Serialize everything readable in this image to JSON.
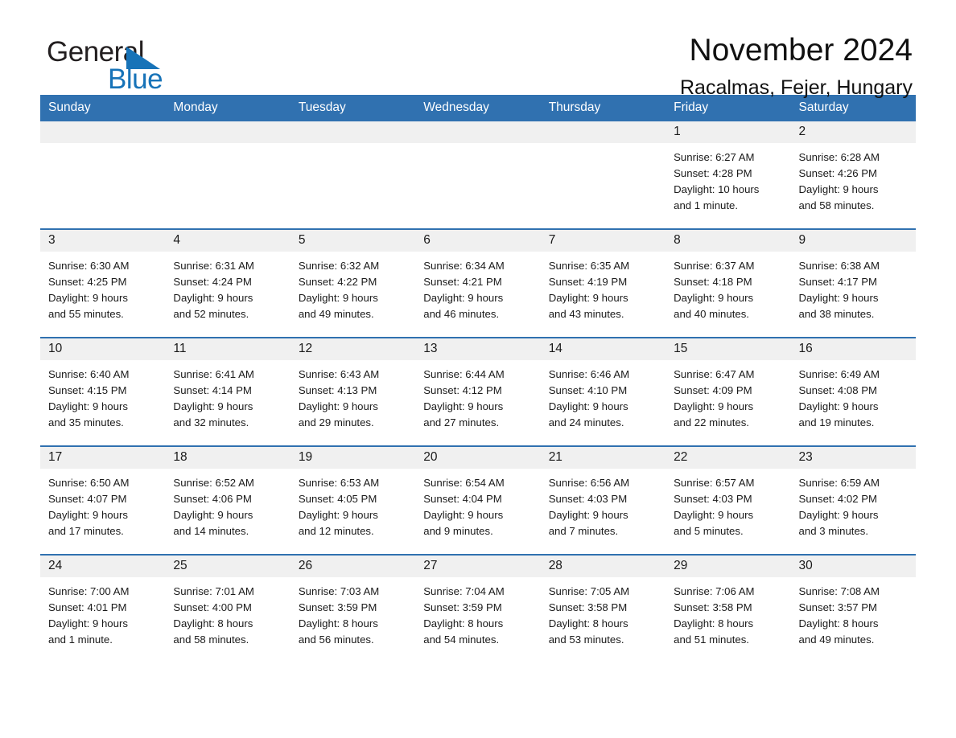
{
  "brand": {
    "name_part1": "General",
    "name_part2": "Blue",
    "accent_color": "#1773b8"
  },
  "header": {
    "month_title": "November 2024",
    "location": "Racalmas, Fejer, Hungary"
  },
  "calendar": {
    "header_bg": "#3071b0",
    "daynum_bg": "#f0f0f0",
    "weekday_headers": [
      "Sunday",
      "Monday",
      "Tuesday",
      "Wednesday",
      "Thursday",
      "Friday",
      "Saturday"
    ],
    "weeks": [
      [
        {
          "day": "",
          "lines": []
        },
        {
          "day": "",
          "lines": []
        },
        {
          "day": "",
          "lines": []
        },
        {
          "day": "",
          "lines": []
        },
        {
          "day": "",
          "lines": []
        },
        {
          "day": "1",
          "lines": [
            "Sunrise: 6:27 AM",
            "Sunset: 4:28 PM",
            "Daylight: 10 hours",
            "and 1 minute."
          ]
        },
        {
          "day": "2",
          "lines": [
            "Sunrise: 6:28 AM",
            "Sunset: 4:26 PM",
            "Daylight: 9 hours",
            "and 58 minutes."
          ]
        }
      ],
      [
        {
          "day": "3",
          "lines": [
            "Sunrise: 6:30 AM",
            "Sunset: 4:25 PM",
            "Daylight: 9 hours",
            "and 55 minutes."
          ]
        },
        {
          "day": "4",
          "lines": [
            "Sunrise: 6:31 AM",
            "Sunset: 4:24 PM",
            "Daylight: 9 hours",
            "and 52 minutes."
          ]
        },
        {
          "day": "5",
          "lines": [
            "Sunrise: 6:32 AM",
            "Sunset: 4:22 PM",
            "Daylight: 9 hours",
            "and 49 minutes."
          ]
        },
        {
          "day": "6",
          "lines": [
            "Sunrise: 6:34 AM",
            "Sunset: 4:21 PM",
            "Daylight: 9 hours",
            "and 46 minutes."
          ]
        },
        {
          "day": "7",
          "lines": [
            "Sunrise: 6:35 AM",
            "Sunset: 4:19 PM",
            "Daylight: 9 hours",
            "and 43 minutes."
          ]
        },
        {
          "day": "8",
          "lines": [
            "Sunrise: 6:37 AM",
            "Sunset: 4:18 PM",
            "Daylight: 9 hours",
            "and 40 minutes."
          ]
        },
        {
          "day": "9",
          "lines": [
            "Sunrise: 6:38 AM",
            "Sunset: 4:17 PM",
            "Daylight: 9 hours",
            "and 38 minutes."
          ]
        }
      ],
      [
        {
          "day": "10",
          "lines": [
            "Sunrise: 6:40 AM",
            "Sunset: 4:15 PM",
            "Daylight: 9 hours",
            "and 35 minutes."
          ]
        },
        {
          "day": "11",
          "lines": [
            "Sunrise: 6:41 AM",
            "Sunset: 4:14 PM",
            "Daylight: 9 hours",
            "and 32 minutes."
          ]
        },
        {
          "day": "12",
          "lines": [
            "Sunrise: 6:43 AM",
            "Sunset: 4:13 PM",
            "Daylight: 9 hours",
            "and 29 minutes."
          ]
        },
        {
          "day": "13",
          "lines": [
            "Sunrise: 6:44 AM",
            "Sunset: 4:12 PM",
            "Daylight: 9 hours",
            "and 27 minutes."
          ]
        },
        {
          "day": "14",
          "lines": [
            "Sunrise: 6:46 AM",
            "Sunset: 4:10 PM",
            "Daylight: 9 hours",
            "and 24 minutes."
          ]
        },
        {
          "day": "15",
          "lines": [
            "Sunrise: 6:47 AM",
            "Sunset: 4:09 PM",
            "Daylight: 9 hours",
            "and 22 minutes."
          ]
        },
        {
          "day": "16",
          "lines": [
            "Sunrise: 6:49 AM",
            "Sunset: 4:08 PM",
            "Daylight: 9 hours",
            "and 19 minutes."
          ]
        }
      ],
      [
        {
          "day": "17",
          "lines": [
            "Sunrise: 6:50 AM",
            "Sunset: 4:07 PM",
            "Daylight: 9 hours",
            "and 17 minutes."
          ]
        },
        {
          "day": "18",
          "lines": [
            "Sunrise: 6:52 AM",
            "Sunset: 4:06 PM",
            "Daylight: 9 hours",
            "and 14 minutes."
          ]
        },
        {
          "day": "19",
          "lines": [
            "Sunrise: 6:53 AM",
            "Sunset: 4:05 PM",
            "Daylight: 9 hours",
            "and 12 minutes."
          ]
        },
        {
          "day": "20",
          "lines": [
            "Sunrise: 6:54 AM",
            "Sunset: 4:04 PM",
            "Daylight: 9 hours",
            "and 9 minutes."
          ]
        },
        {
          "day": "21",
          "lines": [
            "Sunrise: 6:56 AM",
            "Sunset: 4:03 PM",
            "Daylight: 9 hours",
            "and 7 minutes."
          ]
        },
        {
          "day": "22",
          "lines": [
            "Sunrise: 6:57 AM",
            "Sunset: 4:03 PM",
            "Daylight: 9 hours",
            "and 5 minutes."
          ]
        },
        {
          "day": "23",
          "lines": [
            "Sunrise: 6:59 AM",
            "Sunset: 4:02 PM",
            "Daylight: 9 hours",
            "and 3 minutes."
          ]
        }
      ],
      [
        {
          "day": "24",
          "lines": [
            "Sunrise: 7:00 AM",
            "Sunset: 4:01 PM",
            "Daylight: 9 hours",
            "and 1 minute."
          ]
        },
        {
          "day": "25",
          "lines": [
            "Sunrise: 7:01 AM",
            "Sunset: 4:00 PM",
            "Daylight: 8 hours",
            "and 58 minutes."
          ]
        },
        {
          "day": "26",
          "lines": [
            "Sunrise: 7:03 AM",
            "Sunset: 3:59 PM",
            "Daylight: 8 hours",
            "and 56 minutes."
          ]
        },
        {
          "day": "27",
          "lines": [
            "Sunrise: 7:04 AM",
            "Sunset: 3:59 PM",
            "Daylight: 8 hours",
            "and 54 minutes."
          ]
        },
        {
          "day": "28",
          "lines": [
            "Sunrise: 7:05 AM",
            "Sunset: 3:58 PM",
            "Daylight: 8 hours",
            "and 53 minutes."
          ]
        },
        {
          "day": "29",
          "lines": [
            "Sunrise: 7:06 AM",
            "Sunset: 3:58 PM",
            "Daylight: 8 hours",
            "and 51 minutes."
          ]
        },
        {
          "day": "30",
          "lines": [
            "Sunrise: 7:08 AM",
            "Sunset: 3:57 PM",
            "Daylight: 8 hours",
            "and 49 minutes."
          ]
        }
      ]
    ]
  }
}
